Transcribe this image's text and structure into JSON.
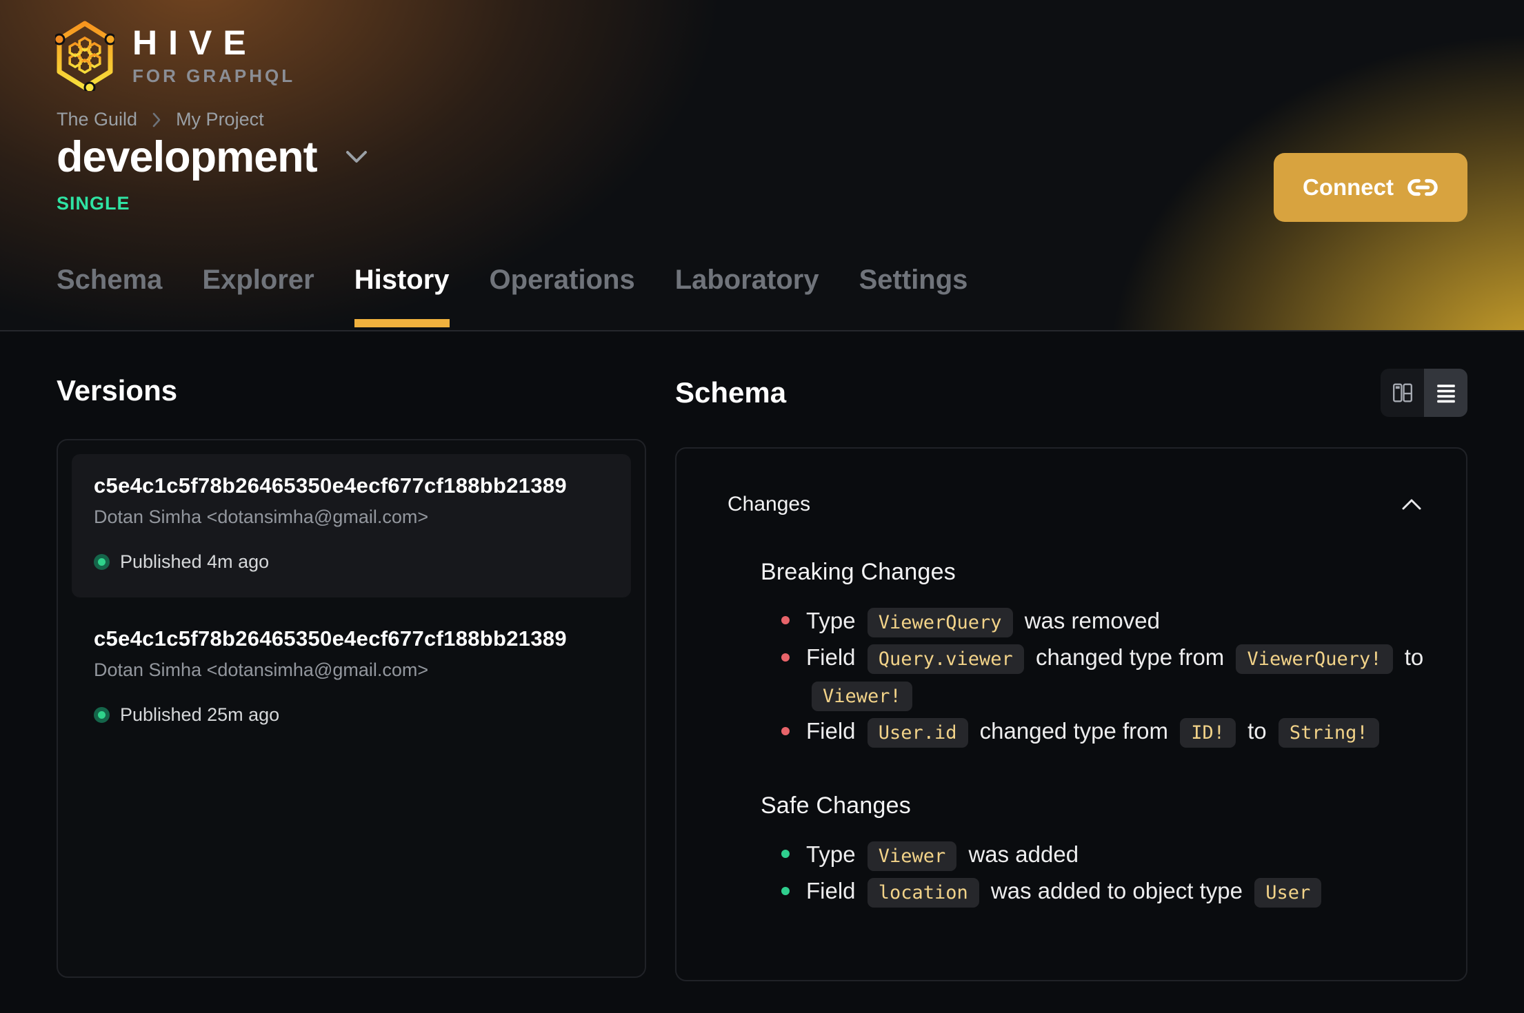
{
  "header": {
    "logo": {
      "title": "HIVE",
      "subtitle": "FOR GRAPHQL"
    },
    "breadcrumb": {
      "items": [
        "The Guild",
        "My Project"
      ]
    },
    "target": {
      "name": "development",
      "badge": "SINGLE"
    },
    "connect_label": "Connect",
    "tabs": [
      {
        "label": "Schema",
        "active": false
      },
      {
        "label": "Explorer",
        "active": false
      },
      {
        "label": "History",
        "active": true
      },
      {
        "label": "Operations",
        "active": false
      },
      {
        "label": "Laboratory",
        "active": false
      },
      {
        "label": "Settings",
        "active": false
      }
    ]
  },
  "versions": {
    "heading": "Versions",
    "items": [
      {
        "hash": "c5e4c1c5f78b26465350e4ecf677cf188bb21389",
        "author": "Dotan Simha <dotansimha@gmail.com>",
        "status": "Published 4m ago",
        "selected": true
      },
      {
        "hash": "c5e4c1c5f78b26465350e4ecf677cf188bb21389",
        "author": "Dotan Simha <dotansimha@gmail.com>",
        "status": "Published 25m ago",
        "selected": false
      }
    ]
  },
  "schema": {
    "heading": "Schema",
    "view_toggle": {
      "options": [
        "columns-view",
        "list-view"
      ],
      "selected_index": 1
    },
    "changes": {
      "title": "Changes",
      "collapsed": false,
      "sections": [
        {
          "title": "Breaking Changes",
          "severity": "breaking",
          "items": [
            [
              {
                "t": "text",
                "v": "Type"
              },
              {
                "t": "code",
                "v": "ViewerQuery"
              },
              {
                "t": "text",
                "v": "was removed"
              }
            ],
            [
              {
                "t": "text",
                "v": "Field"
              },
              {
                "t": "code",
                "v": "Query.viewer"
              },
              {
                "t": "text",
                "v": "changed type from"
              },
              {
                "t": "code",
                "v": "ViewerQuery!"
              },
              {
                "t": "text",
                "v": "to"
              },
              {
                "t": "code",
                "v": "Viewer!"
              }
            ],
            [
              {
                "t": "text",
                "v": "Field"
              },
              {
                "t": "code",
                "v": "User.id"
              },
              {
                "t": "text",
                "v": "changed type from"
              },
              {
                "t": "code",
                "v": "ID!"
              },
              {
                "t": "text",
                "v": "to"
              },
              {
                "t": "code",
                "v": "String!"
              }
            ]
          ]
        },
        {
          "title": "Safe Changes",
          "severity": "safe",
          "items": [
            [
              {
                "t": "text",
                "v": "Type"
              },
              {
                "t": "code",
                "v": "Viewer"
              },
              {
                "t": "text",
                "v": "was added"
              }
            ],
            [
              {
                "t": "text",
                "v": "Field"
              },
              {
                "t": "code",
                "v": "location"
              },
              {
                "t": "text",
                "v": "was added to object type"
              },
              {
                "t": "code",
                "v": "User"
              }
            ]
          ]
        }
      ]
    }
  },
  "icons": {
    "logo": "hive-hexagon-logo",
    "breadcrumb_separator": "chevron-right-icon",
    "target_selector": "chevron-down-icon",
    "connect": "link-icon",
    "toggle_left": "columns-view-icon",
    "toggle_right": "list-view-icon",
    "accordion": "chevron-up-icon",
    "published": "green-status-dot"
  },
  "colors": {
    "accent_underline": "#f0b13e",
    "connect_button": "#d8a33f",
    "badge_green": "#2fe3a3",
    "published_dot": "#2fd38b",
    "breaking_bullet": "#e8646a",
    "safe_bullet": "#2fcf8e",
    "chip_text": "#f2d389",
    "chip_bg": "#26272b",
    "page_bg": "#0a0c0f"
  }
}
